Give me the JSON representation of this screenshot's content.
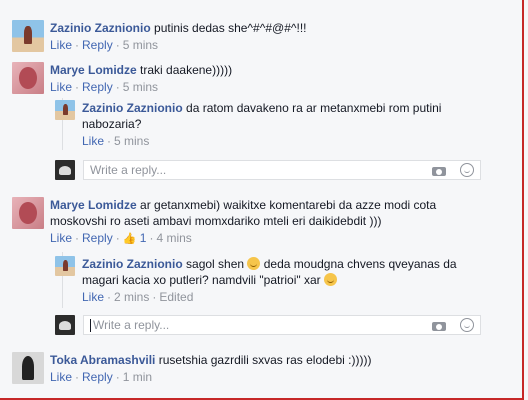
{
  "actions": {
    "like": "Like",
    "reply": "Reply"
  },
  "reply_placeholder": "Write a reply...",
  "comments": [
    {
      "name": "Zazinio Zaznionio",
      "text": "putinis dedas she^#^#@#^!!!",
      "time": "5 mins"
    },
    {
      "name": "Marye Lomidze",
      "text": "traki daakene)))))",
      "time": "5 mins"
    },
    {
      "name": "Zazinio Zaznionio",
      "text": "da ratom davakeno ra ar metanxmebi rom putini nabozaria?",
      "time": "5 mins"
    },
    {
      "name": "Marye Lomidze",
      "text": "ar getanxmebi) waikitxe komentarebi da azze modi cota moskovshi ro aseti ambavi momxdariko mteli eri daikidebdit )))",
      "likes": "1",
      "time": "4 mins"
    },
    {
      "name": "Zazinio Zaznionio",
      "text_before": "sagol shen",
      "text_middle": "deda moudgna chvens qveyanas da magari kacia xo putleri? namdvili \"patrioi\" xar",
      "time": "2 mins",
      "edited": "Edited"
    },
    {
      "name": "Toka Abramashvili",
      "text": "rusetshia gazrdili sxvas ras elodebi :)))))",
      "time": "1 min"
    }
  ],
  "icons": {
    "camera": "camera-icon",
    "emoji": "smile-icon",
    "like": "thumbs-up-icon"
  },
  "colors": {
    "name": "#3b5998",
    "link": "#4267b2",
    "meta": "#90949c",
    "border": "#c62828"
  }
}
